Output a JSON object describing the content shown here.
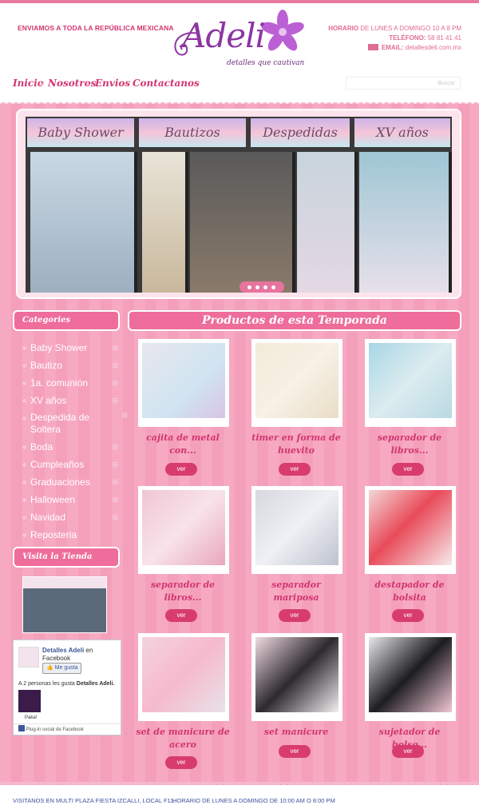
{
  "header": {
    "shipping": "ENVIAMOS A TODA LA REPÚBLICA MEXICANA",
    "logo_name": "Adeli",
    "logo_tagline": "detalles que cautivan",
    "schedule_label": "HORARIO",
    "schedule": "DE LUNES A DOMINGO 10 A  8 PM",
    "phone_label": "TELÉFONO:",
    "phone": "58 81 41 41",
    "email_label": "EMAIL:",
    "email": "detallesdeli.com.mx"
  },
  "nav": {
    "items": [
      "Inicio",
      "Nosotros",
      "Envios",
      "Contactanos"
    ],
    "search_placeholder": "Buscar"
  },
  "slider": {
    "banners": [
      "Baby Shower",
      "Bautizos",
      "Despedidas",
      "XV años Bodas"
    ]
  },
  "sidebar": {
    "categories_title": "Categories",
    "categories": [
      {
        "label": "Baby Shower",
        "has_sub": true
      },
      {
        "label": "Bautizo",
        "has_sub": true
      },
      {
        "label": "1a. comunión",
        "has_sub": true
      },
      {
        "label": "XV años",
        "has_sub": true
      },
      {
        "label": "Despedida de Soltera",
        "has_sub": true
      },
      {
        "label": "Boda",
        "has_sub": true
      },
      {
        "label": "Cumpleaños",
        "has_sub": true
      },
      {
        "label": "Graduaciones",
        "has_sub": true
      },
      {
        "label": "Halloween",
        "has_sub": true
      },
      {
        "label": "Navidad",
        "has_sub": true
      },
      {
        "label": "Reposteria",
        "has_sub": false
      }
    ],
    "visit_title": "Visita la Tienda",
    "facebook": {
      "page_name": "Detalles Adeli",
      "on": "en",
      "network": "Facebook",
      "like_button": "Me gusta",
      "likes_text": "A 2 personas les gusta",
      "likes_page": "Detalles Adeli.",
      "friend_name": "Paka!",
      "plugin_label": "Plug-in social de Facebook"
    }
  },
  "products": {
    "title": "Productos de esta Temporada",
    "button_label": "ver",
    "items": [
      {
        "name": "cajita de metal con..."
      },
      {
        "name": "timer en forma de huevito"
      },
      {
        "name": "separador de libros..."
      },
      {
        "name": "separador de libros..."
      },
      {
        "name": "separador mariposa"
      },
      {
        "name": "destapador de bolsita"
      },
      {
        "name": "set de manicure de acero"
      },
      {
        "name": "set manicure"
      },
      {
        "name": "sujetador de bolso..."
      }
    ]
  },
  "footer": {
    "address": "VISITANOS EN MULTI PLAZA FIESTA IZCALLI, LOCAL F11.",
    "hours": "HORARIO DE LUNES A DOMINGO DE 10:00 AM O 8:00 PM"
  },
  "colors": {
    "brand_pink": "#d2356f",
    "accent_pink": "#ee6d9a",
    "logo_purple": "#8d35a4",
    "footer_blue": "#3f4fa0"
  }
}
